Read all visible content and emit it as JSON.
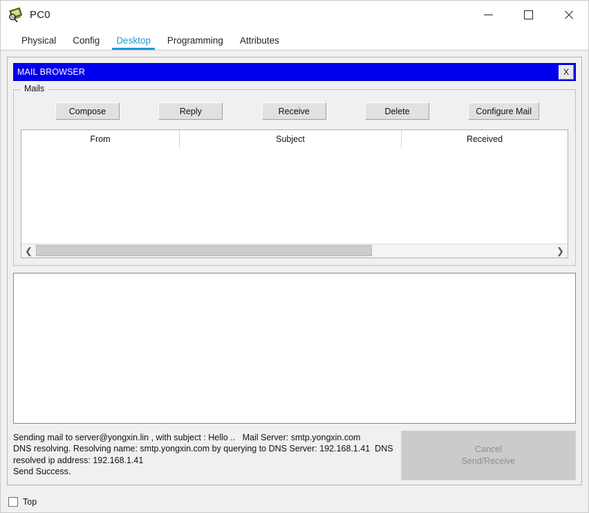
{
  "window": {
    "title": "PC0",
    "icon": "pc-device-icon",
    "controls": {
      "minimize": "minimize-icon",
      "maximize": "maximize-icon",
      "close": "close-icon"
    }
  },
  "tabs": [
    {
      "label": "Physical",
      "active": false
    },
    {
      "label": "Config",
      "active": false
    },
    {
      "label": "Desktop",
      "active": true
    },
    {
      "label": "Programming",
      "active": false
    },
    {
      "label": "Attributes",
      "active": false
    }
  ],
  "mail_browser": {
    "title": "MAIL BROWSER",
    "close_label": "X",
    "group_legend": "Mails",
    "buttons": [
      {
        "label": "Compose"
      },
      {
        "label": "Reply"
      },
      {
        "label": "Receive"
      },
      {
        "label": "Delete"
      },
      {
        "label": "Configure Mail"
      }
    ],
    "table": {
      "columns": [
        "From",
        "Subject",
        "Received"
      ],
      "rows": []
    },
    "scrollbar": {
      "left_arrow": "chevron-left-icon",
      "right_arrow": "chevron-right-icon"
    },
    "message_body": "",
    "status_text": "Sending mail to server@yongxin.lin , with subject : Hello ..   Mail Server: smtp.yongxin.com\nDNS resolving. Resolving name: smtp.yongxin.com by querying to DNS Server: 192.168.1.41  DNS resolved ip address: 192.168.1.41\nSend Success.",
    "cancel_button": {
      "line1": "Cancel",
      "line2": "Send/Receive",
      "disabled": true
    }
  },
  "footer": {
    "top_checkbox_label": "Top",
    "top_checked": false
  },
  "colors": {
    "accent_tab": "#1e9ad6",
    "titlebar_blue": "#0000ee",
    "panel_bg": "#f0f0f0",
    "button_face": "#e1e1e1",
    "disabled_text": "#8d8d8d"
  }
}
